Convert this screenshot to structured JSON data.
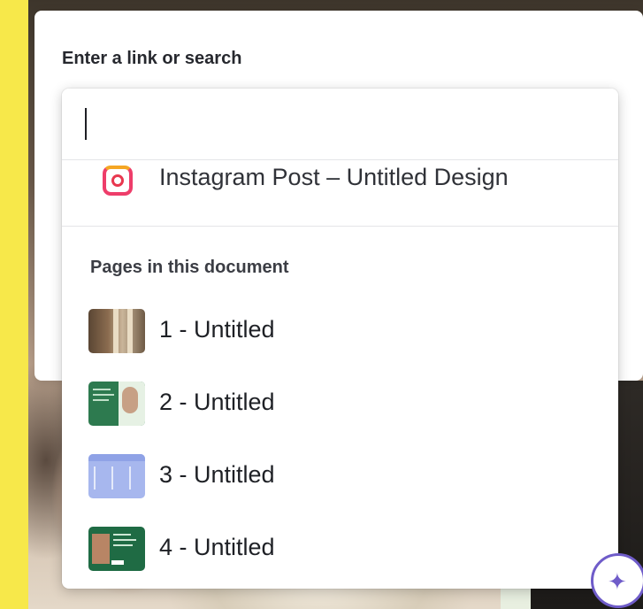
{
  "panel": {
    "title": "Enter a link or search",
    "search_value": ""
  },
  "suggestion": {
    "label": "Instagram Post – Untitled Design",
    "icon": "instagram-icon"
  },
  "pages_section": {
    "heading": "Pages in this document",
    "items": [
      {
        "label": "1 - Untitled",
        "thumb": "page-thumbnail"
      },
      {
        "label": "2 - Untitled",
        "thumb": "page-thumbnail"
      },
      {
        "label": "3 - Untitled",
        "thumb": "page-thumbnail"
      },
      {
        "label": "4 - Untitled",
        "thumb": "page-thumbnail"
      }
    ]
  },
  "fab": {
    "icon": "sparkle-icon"
  },
  "colors": {
    "background": "#f7e84a",
    "panel": "#ffffff",
    "text": "#1e2025",
    "accent": "#6f5cc9"
  }
}
